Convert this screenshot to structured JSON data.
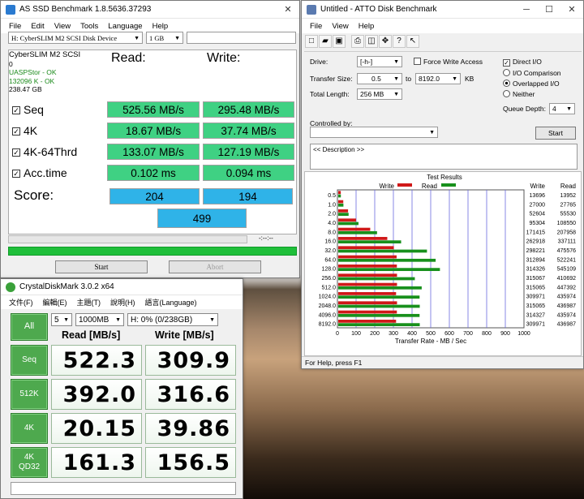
{
  "asssd": {
    "title": "AS SSD Benchmark 1.8.5636.37293",
    "menu": [
      "File",
      "Edit",
      "View",
      "Tools",
      "Language",
      "Help"
    ],
    "drive_select": "H:  CyberSLIM M2 SCSI Disk Device",
    "size_select": "1 GB",
    "info": [
      "CyberSLIM M2 SCSI",
      "0",
      "UASPStor - OK",
      "132096 K - OK",
      "238.47 GB"
    ],
    "read_header": "Read:",
    "write_header": "Write:",
    "tests": [
      {
        "label": "Seq",
        "read": "525.56 MB/s",
        "write": "295.48 MB/s"
      },
      {
        "label": "4K",
        "read": "18.67 MB/s",
        "write": "37.74 MB/s"
      },
      {
        "label": "4K-64Thrd",
        "read": "133.07 MB/s",
        "write": "127.19 MB/s"
      },
      {
        "label": "Acc.time",
        "read": "0.102 ms",
        "write": "0.094 ms"
      }
    ],
    "score_label": "Score:",
    "score_read": "204",
    "score_write": "194",
    "score_total": "499",
    "progress_time": "-:--:--",
    "start": "Start",
    "abort": "Abort"
  },
  "atto": {
    "title": "Untitled - ATTO Disk Benchmark",
    "menu": [
      "File",
      "View",
      "Help"
    ],
    "drive_label": "Drive:",
    "drive_value": "[-h-]",
    "force_write": "Force Write Access",
    "direct_io": "Direct I/O",
    "transfer_label": "Transfer Size:",
    "transfer_from": "0.5",
    "to": "to",
    "transfer_to": "8192.0",
    "kb": "KB",
    "io_comparison": "I/O Comparison",
    "overlapped": "Overlapped I/O",
    "neither": "Neither",
    "total_label": "Total Length:",
    "total_value": "256 MB",
    "queue_label": "Queue Depth:",
    "queue_value": "4",
    "controlled_by": "Controlled by:",
    "start": "Start",
    "description": "<< Description >>",
    "status": "For Help, press F1"
  },
  "chart_data": {
    "type": "bar",
    "title": "Test Results",
    "xlabel": "Transfer Rate - MB / Sec",
    "xlim": [
      0,
      1000
    ],
    "xticks": [
      "0",
      "100",
      "200",
      "300",
      "400",
      "500",
      "600",
      "700",
      "800",
      "900",
      "1000"
    ],
    "categories": [
      "0.5",
      "1.0",
      "2.0",
      "4.0",
      "8.0",
      "16.0",
      "32.0",
      "64.0",
      "128.0",
      "256.0",
      "512.0",
      "1024.0",
      "2048.0",
      "4096.0",
      "8192.0"
    ],
    "series": [
      {
        "name": "Write",
        "color": "#d01818",
        "values": [
          13.7,
          27.0,
          52.6,
          95.3,
          171.4,
          262.9,
          298.2,
          312.9,
          314.3,
          315.1,
          315.1,
          310.0,
          315.1,
          314.3,
          310.0
        ]
      },
      {
        "name": "Read",
        "color": "#18901c",
        "values": [
          14.0,
          27.8,
          55.5,
          108.6,
          208.0,
          337.1,
          475.6,
          522.2,
          545.1,
          410.7,
          447.4,
          436.0,
          437.0,
          436.0,
          437.0
        ]
      }
    ],
    "col_write": "Write",
    "col_read": "Read",
    "write_text": [
      "13696",
      "27000",
      "52604",
      "95304",
      "171415",
      "262918",
      "298221",
      "312894",
      "314326",
      "315067",
      "315065",
      "309971",
      "315065",
      "314327",
      "309971"
    ],
    "read_text": [
      "13952",
      "27765",
      "55530",
      "108550",
      "207958",
      "337111",
      "475576",
      "522241",
      "545109",
      "410692",
      "447392",
      "435974",
      "436987",
      "435974",
      "436987"
    ]
  },
  "cdm": {
    "title": "CrystalDiskMark 3.0.2 x64",
    "menu": [
      "文件(F)",
      "編輯(E)",
      "主題(T)",
      "說明(H)",
      "語言(Language)"
    ],
    "all": "All",
    "runs": "5",
    "size": "1000MB",
    "drive": "H: 0% (0/238GB)",
    "read_header": "Read [MB/s]",
    "write_header": "Write [MB/s]",
    "rows": [
      {
        "label": "Seq",
        "read": "522.3",
        "write": "309.9"
      },
      {
        "label": "512K",
        "read": "392.0",
        "write": "316.6"
      },
      {
        "label": "4K",
        "read": "20.15",
        "write": "39.86"
      },
      {
        "label": "4K\nQD32",
        "read": "161.3",
        "write": "156.5"
      }
    ]
  },
  "colors": {
    "green_box": "#3fd183",
    "blue_box": "#2fb3e8",
    "cdm_green": "#4ea94e"
  }
}
